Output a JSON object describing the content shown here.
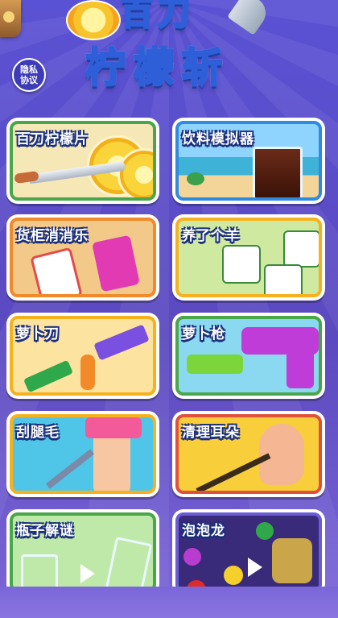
{
  "header": {
    "title_line1": "百刀",
    "title_line2": "柠檬斩",
    "privacy_label": "隐私\n协议"
  },
  "games": [
    {
      "label": "百刀柠檬片"
    },
    {
      "label": "饮料模拟器"
    },
    {
      "label": "货柜消消乐"
    },
    {
      "label": "养了个羊"
    },
    {
      "label": "萝卜刀"
    },
    {
      "label": "萝卜枪"
    },
    {
      "label": "刮腿毛"
    },
    {
      "label": "清理耳朵"
    },
    {
      "label": "瓶子解谜"
    },
    {
      "label": "泡泡龙"
    }
  ],
  "colors": {
    "background": "#5a4fc8",
    "title_outline": "#2e5fd8",
    "frame_green": "#4aa64a",
    "frame_orange": "#f08a2a",
    "frame_yellow": "#f5b21e",
    "frame_purple": "#6a5bd6",
    "label_outline": "#1b2f7a"
  }
}
